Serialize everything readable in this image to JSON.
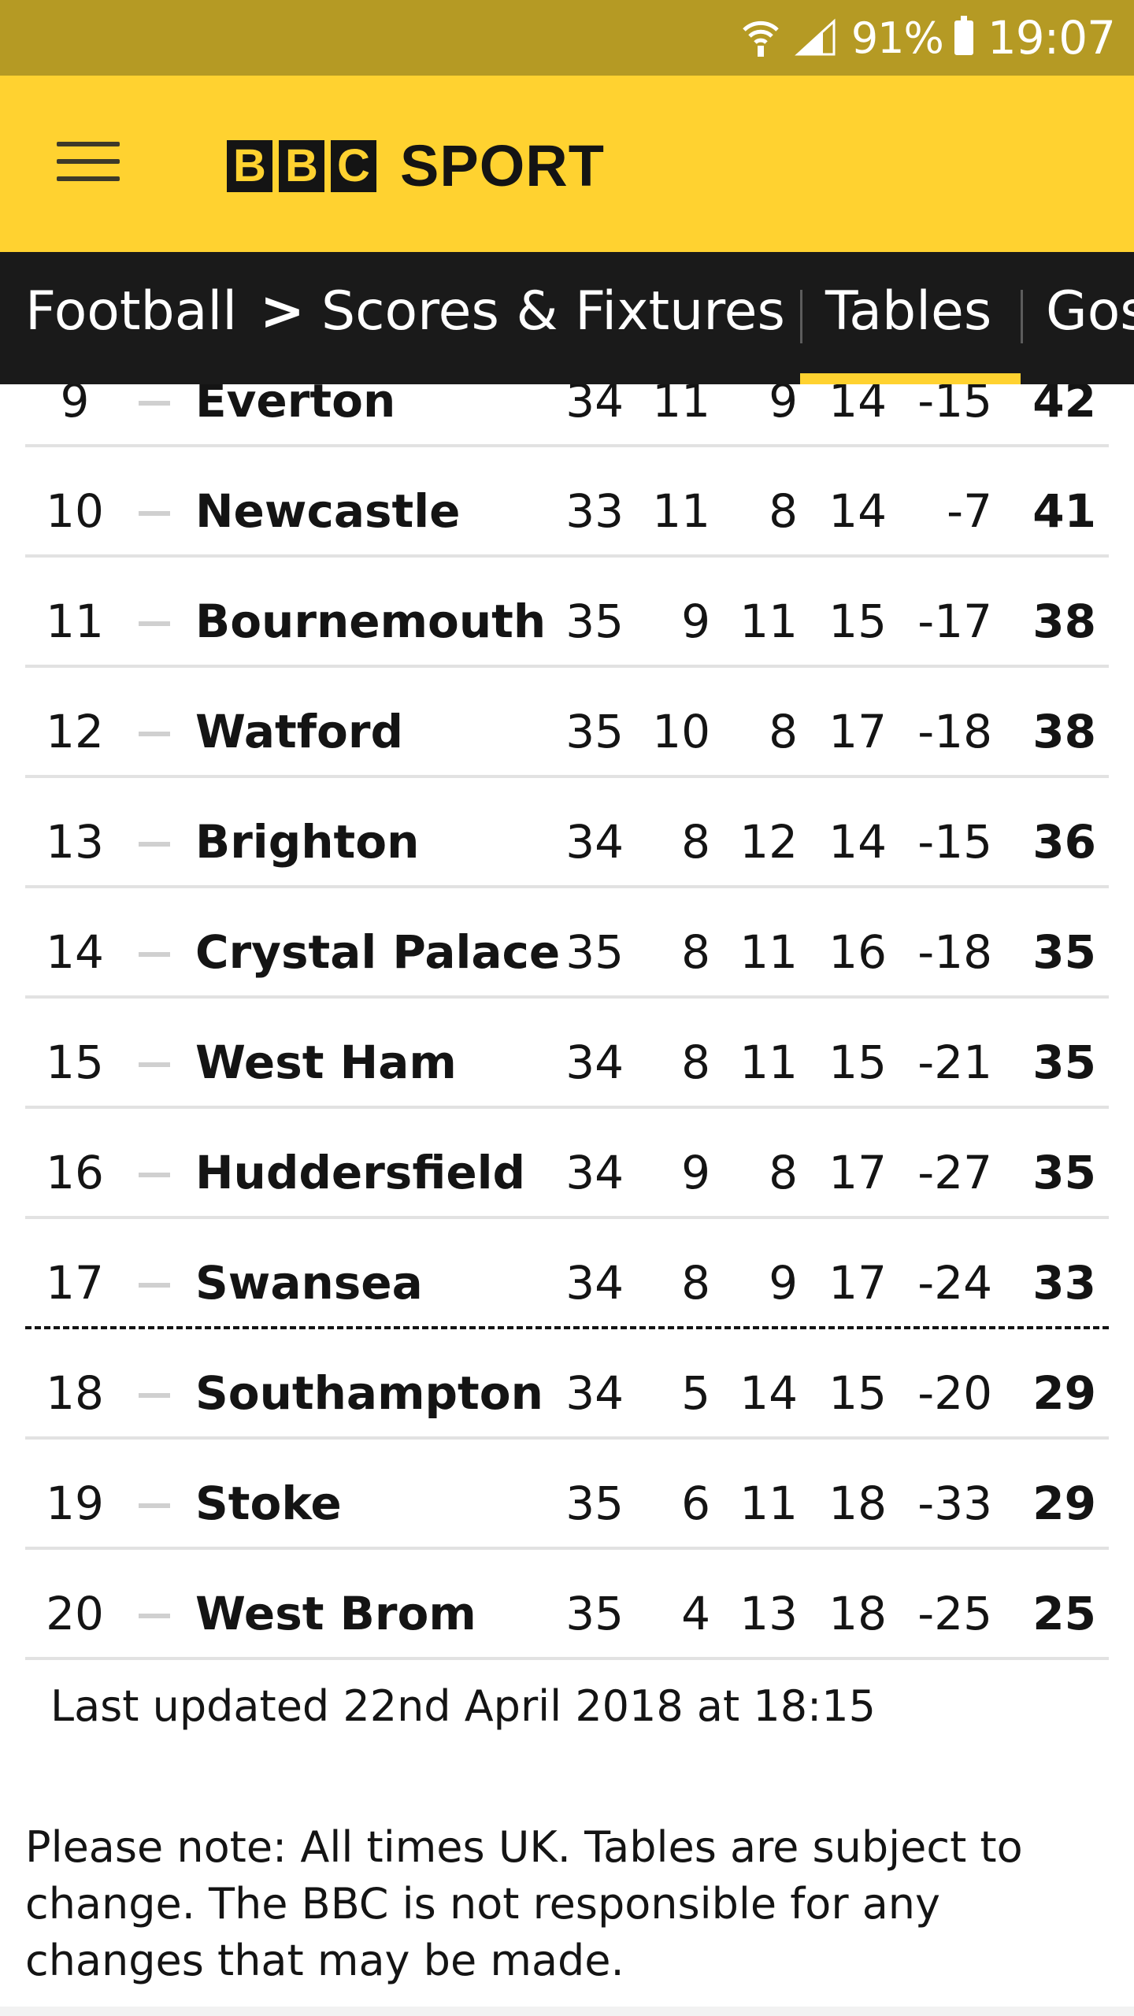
{
  "status_bar": {
    "wifi_icon": "wifi-icon",
    "signal_icon": "signal-icon",
    "battery_icon": "battery-icon",
    "battery_percent": "91%",
    "time": "19:07",
    "color": "#b59a24"
  },
  "header": {
    "menu_icon": "hamburger-menu-icon",
    "brand_letters": [
      "B",
      "B",
      "C"
    ],
    "brand_word": "SPORT",
    "color": "#ffd230"
  },
  "nav": {
    "items": [
      "Football",
      "Scores & Fixtures",
      "Tables",
      "Gos"
    ],
    "breadcrumb_separator": ">",
    "active": "Tables",
    "accent": "#ffd230"
  },
  "table": {
    "rows": [
      {
        "pos": "9",
        "team": "Everton",
        "p": "34",
        "w": "11",
        "d": "9",
        "l": "14",
        "gd": "-15",
        "pts": "42"
      },
      {
        "pos": "10",
        "team": "Newcastle",
        "p": "33",
        "w": "11",
        "d": "8",
        "l": "14",
        "gd": "-7",
        "pts": "41"
      },
      {
        "pos": "11",
        "team": "Bournemouth",
        "p": "35",
        "w": "9",
        "d": "11",
        "l": "15",
        "gd": "-17",
        "pts": "38"
      },
      {
        "pos": "12",
        "team": "Watford",
        "p": "35",
        "w": "10",
        "d": "8",
        "l": "17",
        "gd": "-18",
        "pts": "38"
      },
      {
        "pos": "13",
        "team": "Brighton",
        "p": "34",
        "w": "8",
        "d": "12",
        "l": "14",
        "gd": "-15",
        "pts": "36"
      },
      {
        "pos": "14",
        "team": "Crystal Palace",
        "p": "35",
        "w": "8",
        "d": "11",
        "l": "16",
        "gd": "-18",
        "pts": "35"
      },
      {
        "pos": "15",
        "team": "West Ham",
        "p": "34",
        "w": "8",
        "d": "11",
        "l": "15",
        "gd": "-21",
        "pts": "35"
      },
      {
        "pos": "16",
        "team": "Huddersfield",
        "p": "34",
        "w": "9",
        "d": "8",
        "l": "17",
        "gd": "-27",
        "pts": "35"
      },
      {
        "pos": "17",
        "team": "Swansea",
        "p": "34",
        "w": "8",
        "d": "9",
        "l": "17",
        "gd": "-24",
        "pts": "33"
      },
      {
        "pos": "18",
        "team": "Southampton",
        "p": "34",
        "w": "5",
        "d": "14",
        "l": "15",
        "gd": "-20",
        "pts": "29"
      },
      {
        "pos": "19",
        "team": "Stoke",
        "p": "35",
        "w": "6",
        "d": "11",
        "l": "18",
        "gd": "-33",
        "pts": "29"
      },
      {
        "pos": "20",
        "team": "West Brom",
        "p": "35",
        "w": "4",
        "d": "13",
        "l": "18",
        "gd": "-25",
        "pts": "25"
      }
    ],
    "movement_icon": "no-change-dash-icon",
    "relegation_line_after_pos": "17"
  },
  "footer": {
    "last_updated": "Last updated 22nd April 2018 at 18:15",
    "note": "Please note: All times UK. Tables are subject to change. The BBC is not responsible for any changes that may be made."
  }
}
